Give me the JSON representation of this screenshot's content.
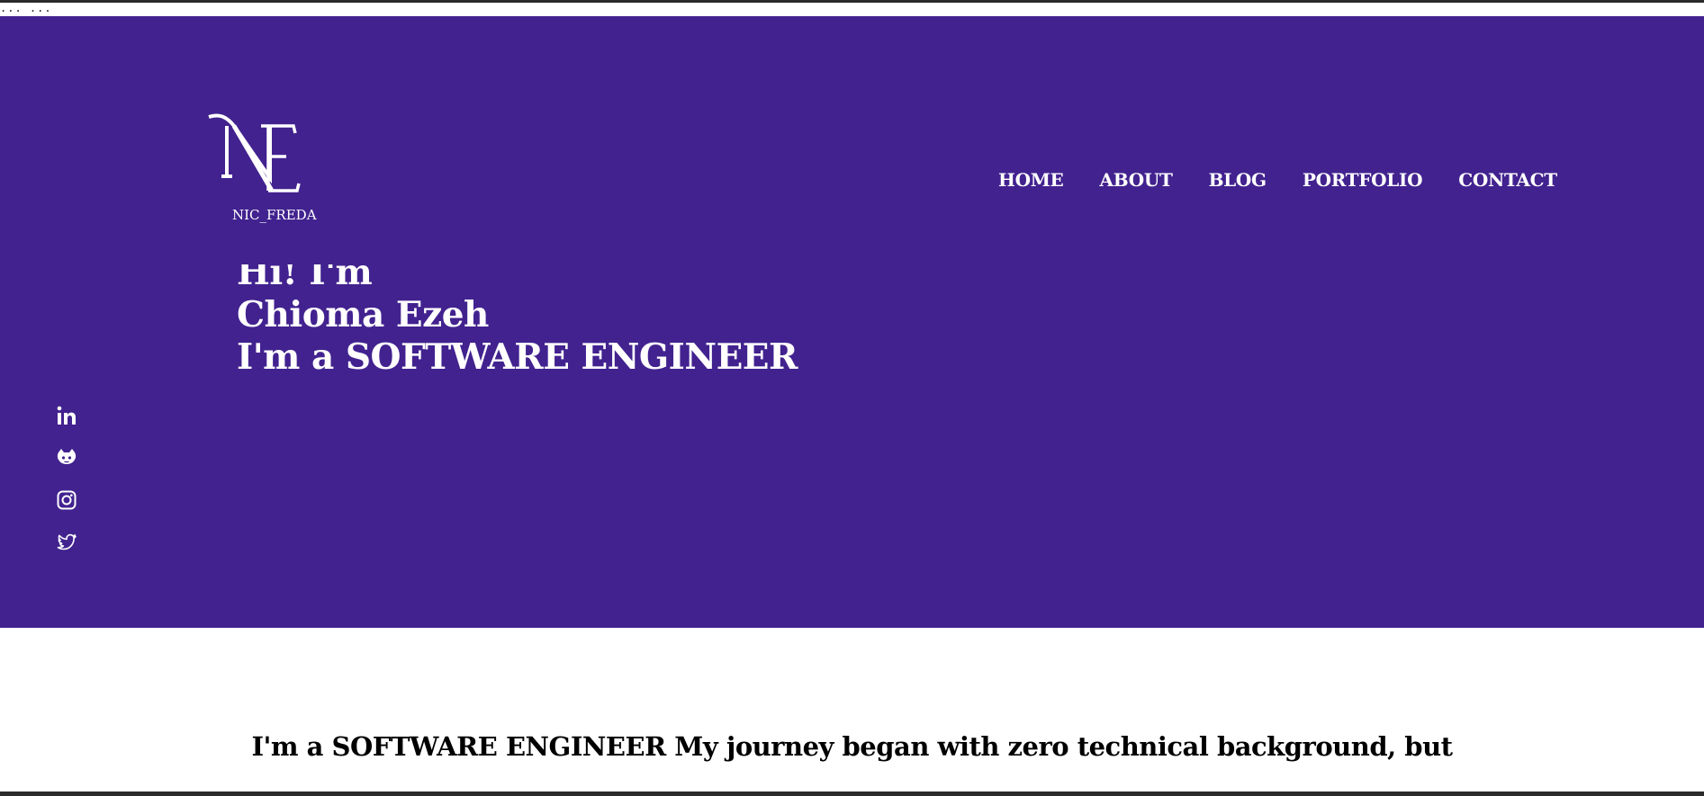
{
  "browser": {
    "top_dots": "... ..."
  },
  "brand": {
    "logo_label": "NIC_FREDA"
  },
  "nav": {
    "items": [
      {
        "label": "HOME"
      },
      {
        "label": "ABOUT"
      },
      {
        "label": "BLOG"
      },
      {
        "label": "PORTFOLIO"
      },
      {
        "label": "CONTACT"
      }
    ]
  },
  "hero": {
    "greeting": "Hi! I'm",
    "name": "Chioma Ezeh",
    "role_line": "I'm a SOFTWARE ENGINEER",
    "background_color": "#42228f"
  },
  "social": {
    "icons": [
      "linkedin-icon",
      "github-icon",
      "instagram-icon",
      "twitter-icon"
    ]
  },
  "about": {
    "line1": "I'm a SOFTWARE ENGINEER My journey began with zero technical background, but"
  }
}
